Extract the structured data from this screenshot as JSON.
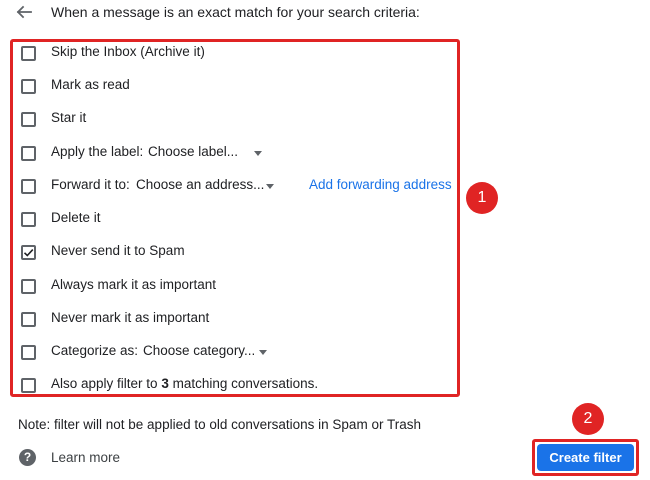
{
  "header": {
    "back_icon": "arrow-left-icon",
    "text": "When a message is an exact match for your search criteria:"
  },
  "options": [
    {
      "label": "Skip the Inbox (Archive it)",
      "checked": false
    },
    {
      "label": "Mark as read",
      "checked": false
    },
    {
      "label": "Star it",
      "checked": false
    },
    {
      "label": "Apply the label:",
      "checked": false,
      "dropdown": "Choose label..."
    },
    {
      "label": "Forward it to:",
      "checked": false,
      "dropdown": "Choose an address...",
      "link": "Add forwarding address"
    },
    {
      "label": "Delete it",
      "checked": false
    },
    {
      "label": "Never send it to Spam",
      "checked": true
    },
    {
      "label": "Always mark it as important",
      "checked": false
    },
    {
      "label": "Never mark it as important",
      "checked": false
    },
    {
      "label": "Categorize as:",
      "checked": false,
      "dropdown": "Choose category..."
    },
    {
      "label_pre": "Also apply filter to ",
      "label_count": "3",
      "label_post": " matching conversations.",
      "checked": false
    }
  ],
  "note": "Note: filter will not be applied to old conversations in Spam or Trash",
  "learn_more": "Learn more",
  "help_icon": "question-circle-icon",
  "create_button": "Create filter",
  "annotations": {
    "badge_1": "1",
    "badge_2": "2"
  },
  "colors": {
    "accent": "#1a73e8",
    "annotation": "#e02424"
  }
}
